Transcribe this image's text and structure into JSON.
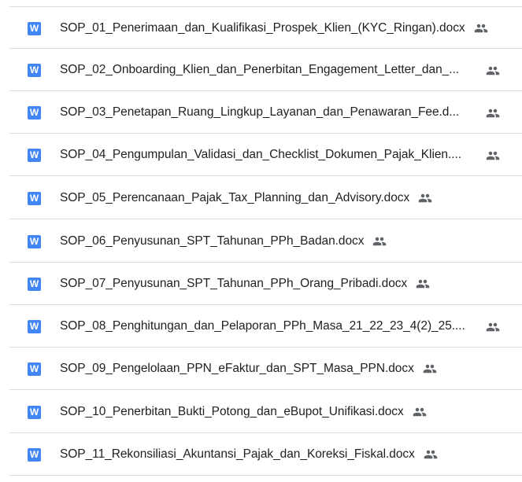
{
  "files": [
    {
      "name": "SOP_01_Penerimaan_dan_Kualifikasi_Prospek_Klien_(KYC_Ringan).docx",
      "app_icon": "W",
      "icon_name": "word-doc-icon",
      "shared_icon": "people-shared-icon"
    },
    {
      "name": "SOP_02_Onboarding_Klien_dan_Penerbitan_Engagement_Letter_dan_...",
      "app_icon": "W",
      "icon_name": "word-doc-icon",
      "shared_icon": "people-shared-icon"
    },
    {
      "name": "SOP_03_Penetapan_Ruang_Lingkup_Layanan_dan_Penawaran_Fee.d...",
      "app_icon": "W",
      "icon_name": "word-doc-icon",
      "shared_icon": "people-shared-icon"
    },
    {
      "name": "SOP_04_Pengumpulan_Validasi_dan_Checklist_Dokumen_Pajak_Klien....",
      "app_icon": "W",
      "icon_name": "word-doc-icon",
      "shared_icon": "people-shared-icon"
    },
    {
      "name": "SOP_05_Perencanaan_Pajak_Tax_Planning_dan_Advisory.docx",
      "app_icon": "W",
      "icon_name": "word-doc-icon",
      "shared_icon": "people-shared-icon"
    },
    {
      "name": "SOP_06_Penyusunan_SPT_Tahunan_PPh_Badan.docx",
      "app_icon": "W",
      "icon_name": "word-doc-icon",
      "shared_icon": "people-shared-icon"
    },
    {
      "name": "SOP_07_Penyusunan_SPT_Tahunan_PPh_Orang_Pribadi.docx",
      "app_icon": "W",
      "icon_name": "word-doc-icon",
      "shared_icon": "people-shared-icon"
    },
    {
      "name": "SOP_08_Penghitungan_dan_Pelaporan_PPh_Masa_21_22_23_4(2)_25....",
      "app_icon": "W",
      "icon_name": "word-doc-icon",
      "shared_icon": "people-shared-icon"
    },
    {
      "name": "SOP_09_Pengelolaan_PPN_eFaktur_dan_SPT_Masa_PPN.docx",
      "app_icon": "W",
      "icon_name": "word-doc-icon",
      "shared_icon": "people-shared-icon"
    },
    {
      "name": "SOP_10_Penerbitan_Bukti_Potong_dan_eBupot_Unifikasi.docx",
      "app_icon": "W",
      "icon_name": "word-doc-icon",
      "shared_icon": "people-shared-icon"
    },
    {
      "name": "SOP_11_Rekonsiliasi_Akuntansi_Pajak_dan_Koreksi_Fiskal.docx",
      "app_icon": "W",
      "icon_name": "word-doc-icon",
      "shared_icon": "people-shared-icon"
    }
  ],
  "colors": {
    "word_icon": "#4285f4",
    "text": "#202124",
    "divider": "#dadce0",
    "shared_icon": "#5f6368"
  }
}
